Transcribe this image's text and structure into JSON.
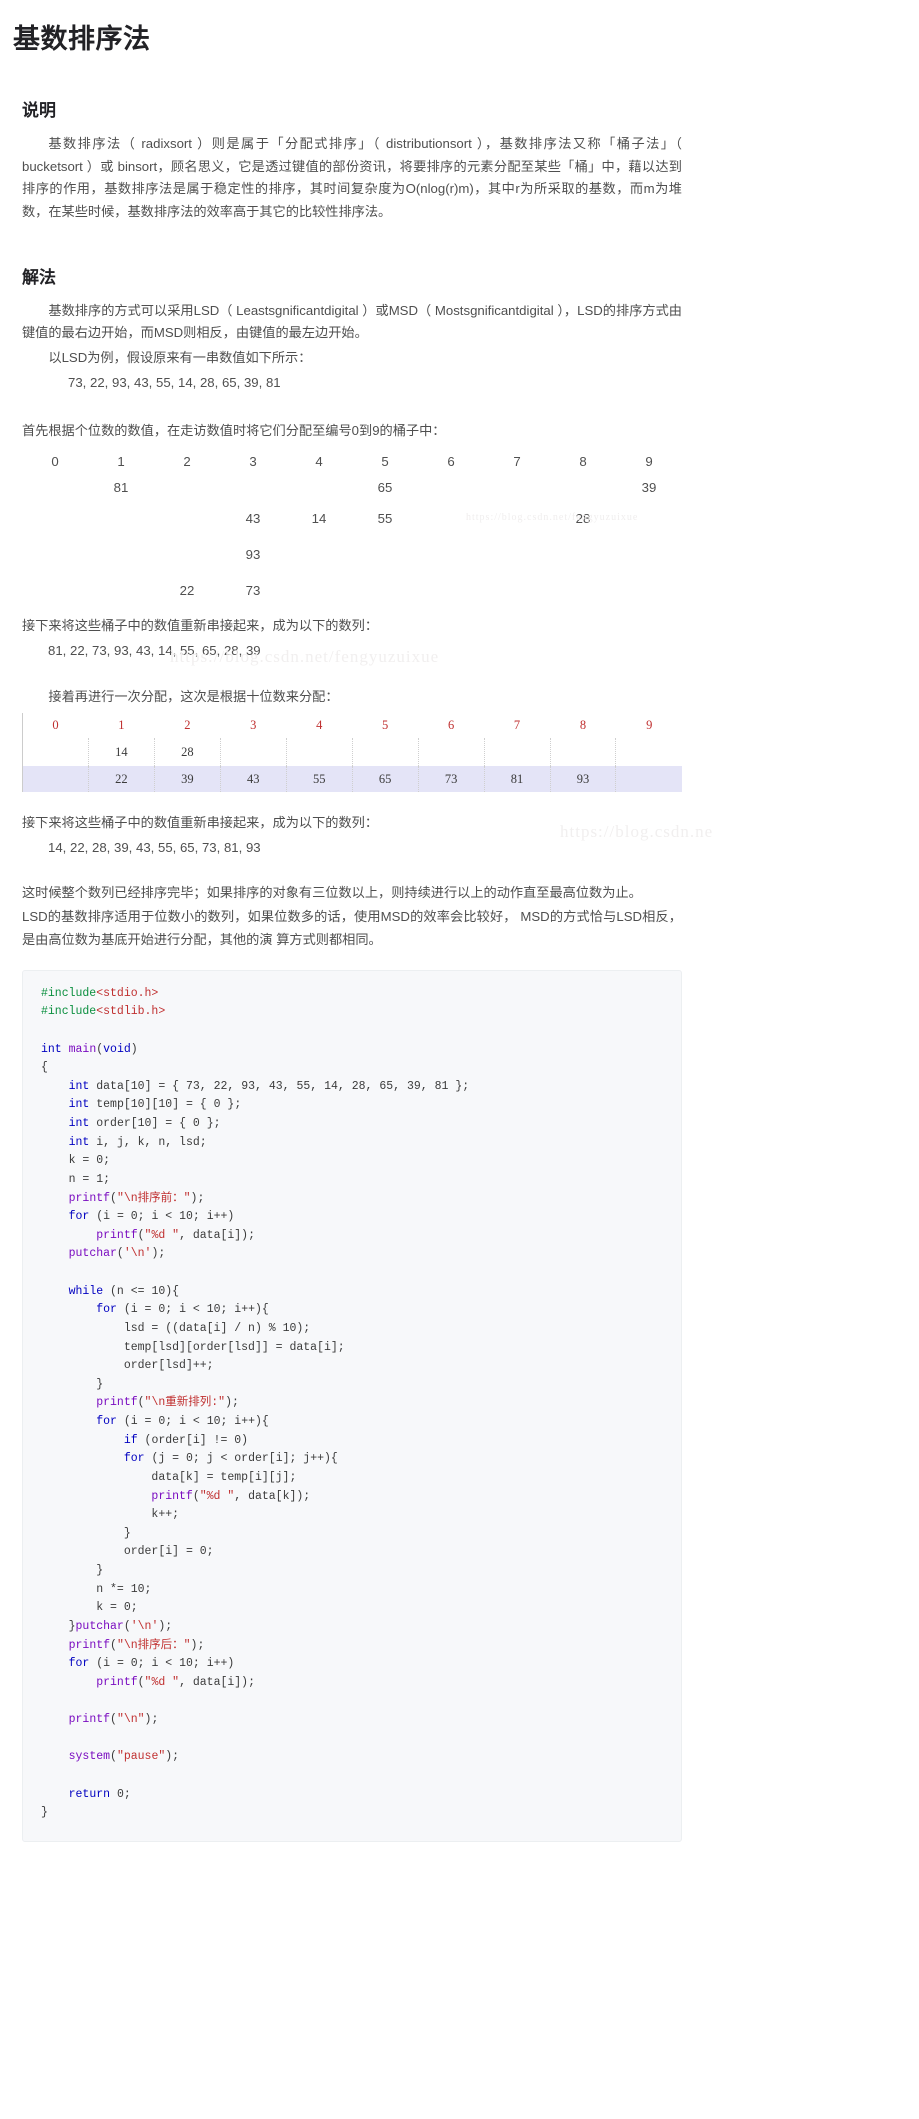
{
  "article": {
    "title": "基数排序法",
    "sections": [
      {
        "heading": "说明"
      },
      {
        "heading": "解法"
      }
    ]
  },
  "description": {
    "heading": "说明",
    "paragraph": "基数排序法（ radixsort ）则是属于「分配式排序」（ distributionsort ），基数排序法又称「桶子法」（ bucketsort ）或 binsort，顾名思义，它是透过键值的部份资讯，将要排序的元素分配至某些「桶」中，藉以达到排序的作用，基数排序法是属于稳定性的排序，其时间复杂度为O(nlog(r)m)，其中r为所采取的基数，而m为堆数，在某些时候，基数排序法的效率高于其它的比较性排序法。"
  },
  "solution": {
    "heading": "解法",
    "p1": "基数排序的方式可以采用LSD（ Leastsgnificantdigital ）或MSD（ Mostsgnificantdigital ），LSD的排序方式由键值的最右边开始，而MSD则相反，由键值的最左边开始。",
    "p2": "以LSD为例，假设原来有一串数值如下所示：",
    "initial_values": "73,  22,  93,  43,  55, 14,  28,  65,  39,  81",
    "p3": "首先根据个位数的数值，在走访数值时将它们分配至编号0到9的桶子中：",
    "p4": "接下来将这些桶子中的数值重新串接起来，成为以下的数列：",
    "after_first_pass": "81,  22,  73,  93,  43, 14,  55,  65,  28,  39",
    "p5": "接着再进行一次分配，这次是根据十位数来分配：",
    "p6": "接下来将这些桶子中的数值重新串接起来，成为以下的数列：",
    "after_second_pass": "14,  22,  28,  39,  43,  55,  65,  73,  81,  93",
    "p7": "这时候整个数列已经排序完毕；如果排序的对象有三位数以上，则持续进行以上的动作直至最高位数为止。",
    "p8": "LSD的基数排序适用于位数小的数列，如果位数多的话，使用MSD的效率会比较好， MSD的方式恰与LSD相反，是由高位数为基底开始进行分配，其他的演 算方式则都相同。"
  },
  "bucket_table_units": {
    "headers": [
      "0",
      "1",
      "2",
      "3",
      "4",
      "5",
      "6",
      "7",
      "8",
      "9"
    ],
    "rows": [
      [
        "",
        "81",
        "",
        "",
        "",
        "65",
        "",
        "",
        "",
        "39"
      ],
      [
        "",
        "",
        "",
        "43",
        "14",
        "55",
        "",
        "",
        "28",
        ""
      ],
      [
        "",
        "",
        "",
        "93",
        "",
        "",
        "",
        "",
        "",
        ""
      ],
      [
        "",
        "",
        "22",
        "73",
        "",
        "",
        "",
        "",
        "",
        ""
      ]
    ]
  },
  "bucket_table_tens": {
    "headers": [
      "0",
      "1",
      "2",
      "3",
      "4",
      "5",
      "6",
      "7",
      "8",
      "9"
    ],
    "rows": [
      [
        "",
        "14",
        "28",
        "",
        "",
        "",
        "",
        "",
        "",
        ""
      ],
      [
        "",
        "22",
        "39",
        "43",
        "55",
        "65",
        "73",
        "81",
        "93",
        ""
      ]
    ],
    "highlight_row_index": 1
  },
  "watermarks": {
    "w1": "https://blog.csdn.net/fengyuzuixue",
    "w2": "https://blog.csdn.net/fengyuzuixue",
    "w3": "https://blog.csdn.ne"
  },
  "code": {
    "language": "c",
    "text": "#include<stdio.h>\n#include<stdlib.h>\n\nint main(void)\n{\n    int data[10] = { 73, 22, 93, 43, 55, 14, 28, 65, 39, 81 };\n    int temp[10][10] = { 0 };\n    int order[10] = { 0 };\n    int i, j, k, n, lsd;\n    k = 0;\n    n = 1;\n    printf(\"\\n排序前：\");\n    for (i = 0; i < 10; i++)\n        printf(\"%d \", data[i]);\n    putchar('\\n');\n\n    while (n <= 10){\n        for (i = 0; i < 10; i++){\n            lsd = ((data[i] / n) % 10);\n            temp[lsd][order[lsd]] = data[i];\n            order[lsd]++;\n        }\n        printf(\"\\n重新排列:\");\n        for (i = 0; i < 10; i++){\n            if (order[i] != 0)\n            for (j = 0; j < order[i]; j++){\n                data[k] = temp[i][j];\n                printf(\"%d \", data[k]);\n                k++;\n            }\n            order[i] = 0;\n        }\n        n *= 10;\n        k = 0;\n    }putchar('\\n');\n    printf(\"\\n排序后：\");\n    for (i = 0; i < 10; i++)\n        printf(\"%d \", data[i]);\n\n    printf(\"\\n\");\n\n    system(\"pause\");\n\n    return 0;\n}"
  }
}
